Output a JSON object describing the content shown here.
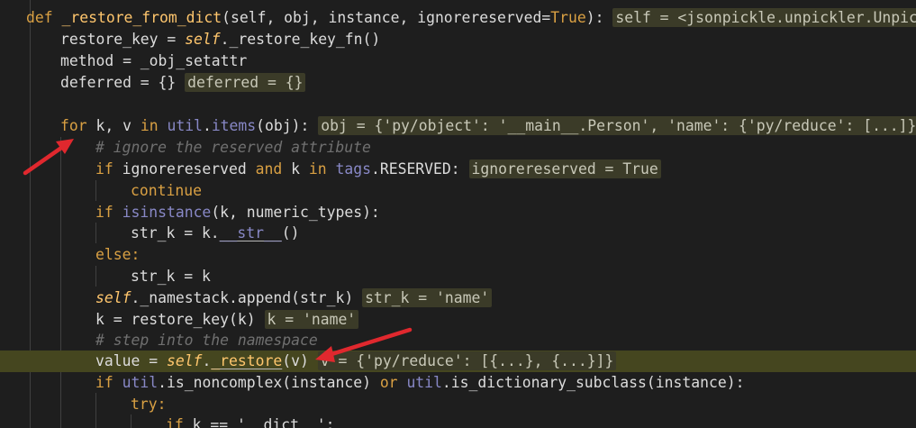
{
  "code": {
    "l1": {
      "def": "def",
      "name": "_restore_from_dict",
      "params": "(self, obj, instance, ignorereserved=",
      "true": "True",
      "close": "):",
      "inline": "self = <jsonpickle.unpickler.Unpickle"
    },
    "l2": {
      "lhs": "restore_key = ",
      "self": "self",
      "rest": "._restore_key_fn()"
    },
    "l3": {
      "text": "method = _obj_setattr"
    },
    "l4": {
      "text": "deferred = {}",
      "inline": "deferred = {}"
    },
    "l5": {
      "for": "for",
      "kv": " k, v ",
      "in": "in",
      "sp": " ",
      "util": "util",
      "dot": ".",
      "items": "items",
      "args": "(obj):",
      "inline": "obj = {'py/object': '__main__.Person', 'name': {'py/reduce': [...]}, '"
    },
    "l6": {
      "text": "# ignore the reserved attribute"
    },
    "l7": {
      "if": "if",
      "a": " ignorereserved ",
      "and": "and",
      "b": " k ",
      "in": "in",
      "sp": " ",
      "tags": "tags",
      "c": ".RESERVED:",
      "inline": "ignorereserved = True"
    },
    "l8": {
      "text": "continue"
    },
    "l9": {
      "if": "if",
      "sp": " ",
      "isinstance": "isinstance",
      "rest": "(k, numeric_types):"
    },
    "l10": {
      "lhs": "str_k = k.",
      "str": "__str__",
      "rest": "()"
    },
    "l11": {
      "text": "else:"
    },
    "l12": {
      "text": "str_k = k"
    },
    "l13": {
      "self": "self",
      "rest": "._namestack.append(str_k)",
      "inline": "str_k = 'name'"
    },
    "l14": {
      "text": "k = restore_key(k)",
      "inline": "k = 'name'"
    },
    "l15": {
      "text": "# step into the namespace"
    },
    "l16": {
      "lhs": "value = ",
      "self": "self",
      "dot": ".",
      "restore": "_restore",
      "rest": "(v)",
      "inline": "v = {'py/reduce': [{...}, {...}]}"
    },
    "l17": {
      "if": "if",
      "sp": " ",
      "util1": "util",
      "a": ".is_noncomplex(instance) ",
      "or": "or",
      "sp2": " ",
      "util2": "util",
      "b": ".is_dictionary_subclass(instance):"
    },
    "l18": {
      "text": "try:"
    },
    "l19": {
      "if": "if",
      "rest": " k == '__dict__':"
    }
  },
  "colors": {
    "background": "#1e1e1e",
    "current_line": "#45461f",
    "keyword": "#d9a043",
    "function": "#ffc66d",
    "builtin": "#8888c6",
    "comment": "#707070",
    "arrow": "#e0282e"
  },
  "annotations": [
    "red-arrow-to-for-loop",
    "red-arrow-to-restore-call"
  ]
}
